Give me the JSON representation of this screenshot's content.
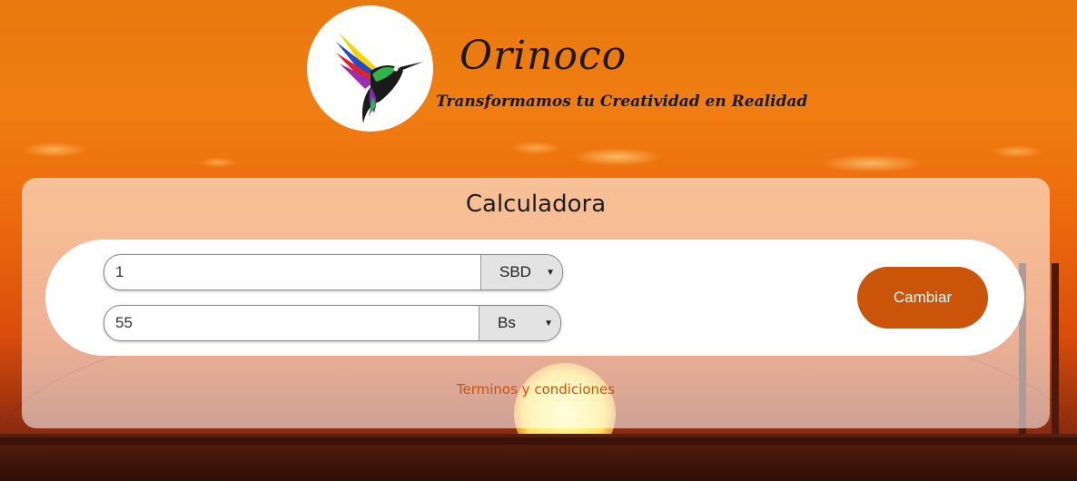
{
  "header": {
    "brand": "Orinoco",
    "tagline": "Transformamos tu Creatividad en Realidad"
  },
  "calculator": {
    "title": "Calculadora",
    "from": {
      "amount": "1",
      "currency": "SBD"
    },
    "to": {
      "amount": "55",
      "currency": "Bs"
    },
    "swap_label": "Cambiar"
  },
  "footer": {
    "terms_link": "Terminos y condiciones"
  },
  "colors": {
    "accent": "#c9540a",
    "background_sky": "#e8790e"
  },
  "icons": {
    "logo": "hummingbird-icon",
    "dropdown": "caret-down-icon"
  }
}
